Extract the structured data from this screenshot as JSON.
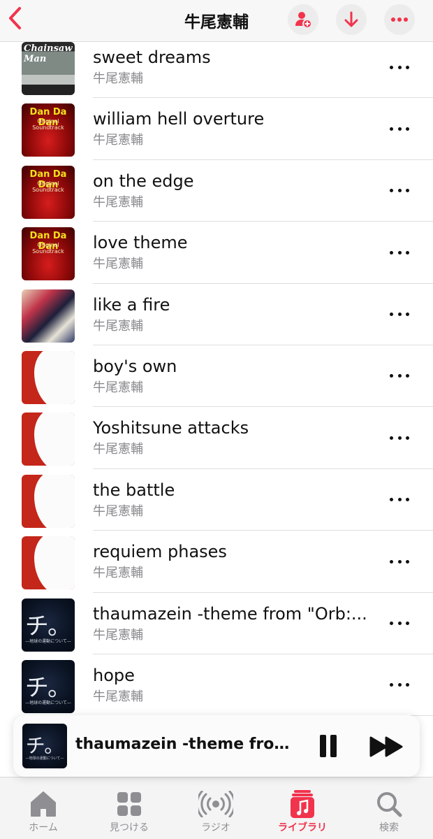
{
  "header": {
    "title": "牛尾憲輔",
    "accent": "#f2334c"
  },
  "songs": [
    {
      "title": "sweet dreams",
      "artist": "牛尾憲輔",
      "art": "chainsaw"
    },
    {
      "title": "william hell overture",
      "artist": "牛尾憲輔",
      "art": "dandan"
    },
    {
      "title": "on the edge",
      "artist": "牛尾憲輔",
      "art": "dandan"
    },
    {
      "title": "love theme",
      "artist": "牛尾憲輔",
      "art": "dandan"
    },
    {
      "title": "like a fire",
      "artist": "牛尾憲輔",
      "art": "fire"
    },
    {
      "title": "boy's own",
      "artist": "牛尾憲輔",
      "art": "red"
    },
    {
      "title": "Yoshitsune attacks",
      "artist": "牛尾憲輔",
      "art": "red"
    },
    {
      "title": "the battle",
      "artist": "牛尾憲輔",
      "art": "red"
    },
    {
      "title": "requiem phases",
      "artist": "牛尾憲輔",
      "art": "red"
    },
    {
      "title": "thaumazein -theme from \"Orb:...",
      "artist": "牛尾憲輔",
      "art": "orb"
    },
    {
      "title": "hope",
      "artist": "牛尾憲輔",
      "art": "orb"
    }
  ],
  "album_art": {
    "chainsaw_logo": "Chainsaw Man",
    "dandan_logo": "Dan Da Dan",
    "dandan_sub": "Original Soundtrack",
    "orb_glyph": "チ。",
    "orb_sub": "—地球の運動について—"
  },
  "player": {
    "title": "thaumazein -theme from \"...",
    "art": "orb"
  },
  "tabs": [
    {
      "label": "ホーム",
      "icon": "home-icon",
      "active": false
    },
    {
      "label": "見つける",
      "icon": "grid-icon",
      "active": false
    },
    {
      "label": "ラジオ",
      "icon": "radio-icon",
      "active": false
    },
    {
      "label": "ライブラリ",
      "icon": "library-icon",
      "active": true
    },
    {
      "label": "検索",
      "icon": "search-icon",
      "active": false
    }
  ]
}
